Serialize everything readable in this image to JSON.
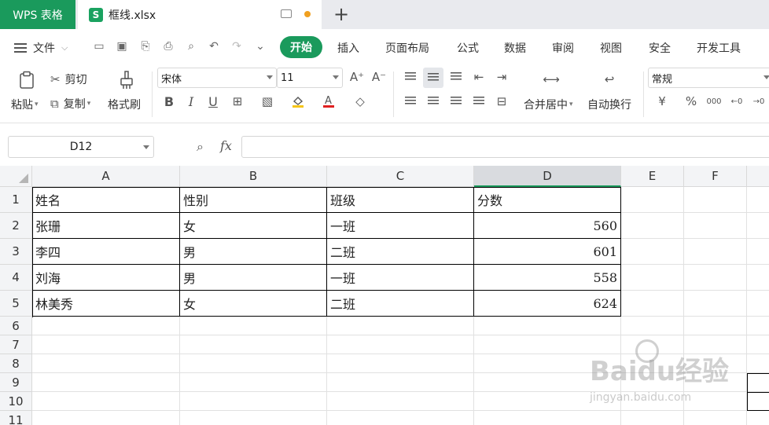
{
  "titlebar": {
    "app_tab": "WPS 表格",
    "file_icon_letter": "S",
    "file_name": "框线.xlsx",
    "new_tab": "+"
  },
  "menubar": {
    "file_menu": "文件",
    "tabs": [
      "开始",
      "插入",
      "页面布局",
      "公式",
      "数据",
      "审阅",
      "视图",
      "安全",
      "开发工具"
    ],
    "active_tab": "开始"
  },
  "ribbon": {
    "paste": "粘贴",
    "cut": "剪切",
    "copy": "复制",
    "format_painter": "格式刷",
    "font_name": "宋体",
    "font_size": "11",
    "bold": "B",
    "italic": "I",
    "underline": "U",
    "merge_center": "合并居中",
    "wrap_text": "自动换行",
    "number_format": "常规",
    "currency": "¥",
    "percent": "%",
    "thousands": "000"
  },
  "formulabar": {
    "name_box": "D12",
    "fx": "fx",
    "formula_value": ""
  },
  "grid": {
    "columns": [
      "A",
      "B",
      "C",
      "D",
      "E",
      "F"
    ],
    "selected_column": "D",
    "rows": [
      "1",
      "2",
      "3",
      "4",
      "5",
      "6",
      "7",
      "8",
      "9",
      "10",
      "11"
    ],
    "table": [
      [
        "姓名",
        "性别",
        "班级",
        "分数"
      ],
      [
        "张珊",
        "女",
        "一班",
        "560"
      ],
      [
        "李四",
        "男",
        "二班",
        "601"
      ],
      [
        "刘海",
        "男",
        "一班",
        "558"
      ],
      [
        "林美秀",
        "女",
        "二班",
        "624"
      ]
    ]
  },
  "watermark": {
    "text": "Baidu经验",
    "sub": "jingyan.baidu.com"
  }
}
